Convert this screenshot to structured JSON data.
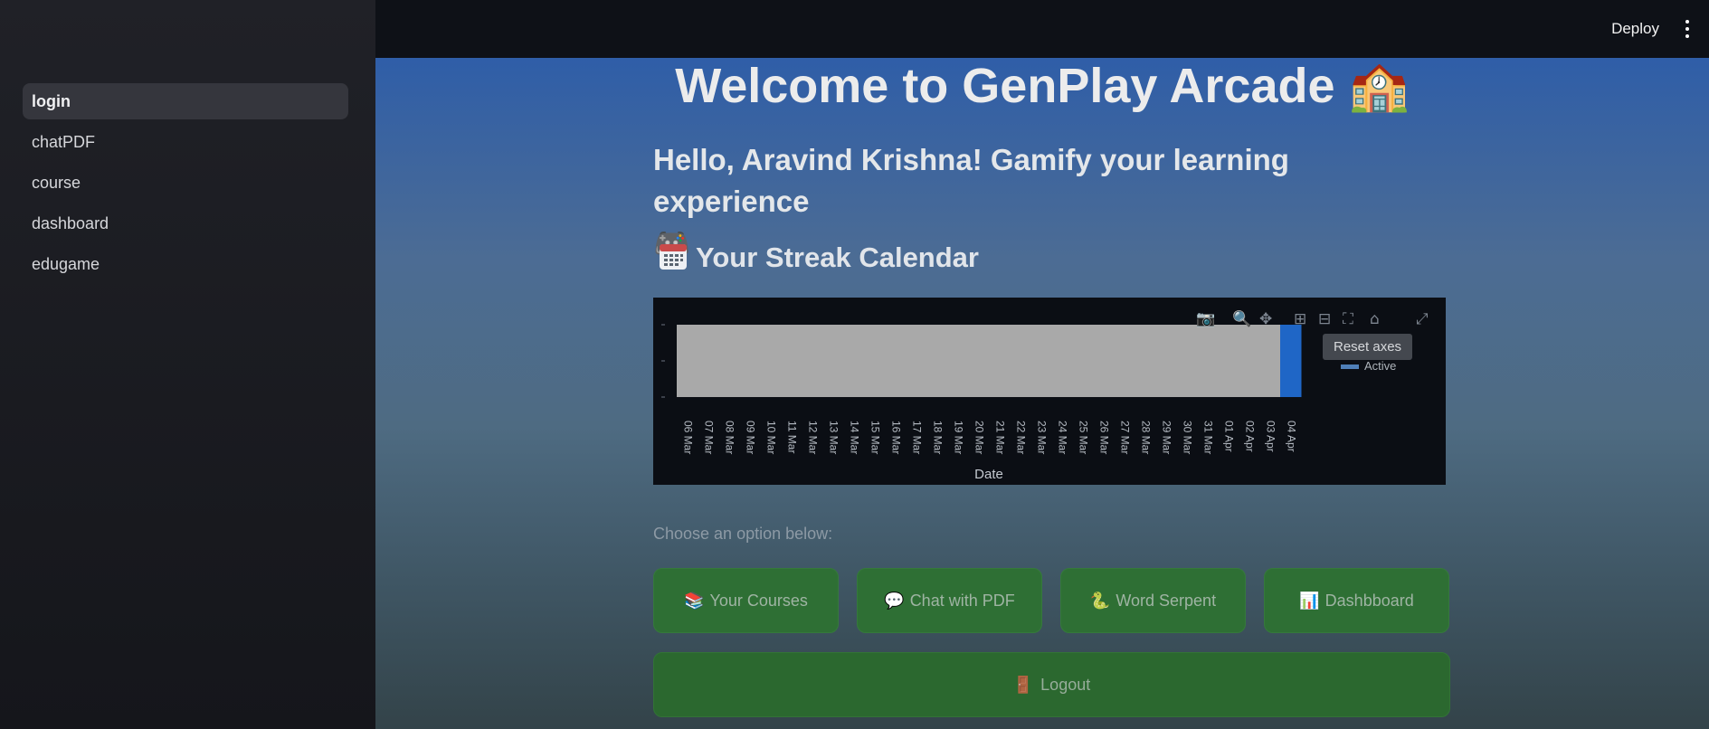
{
  "sidebar": {
    "items": [
      {
        "label": "login",
        "active": true
      },
      {
        "label": "chatPDF"
      },
      {
        "label": "course"
      },
      {
        "label": "dashboard"
      },
      {
        "label": "edugame"
      }
    ]
  },
  "topbar": {
    "deploy_label": "Deploy",
    "menu_icon": "kebab-menu-icon"
  },
  "main": {
    "title": "Welcome to GenPlay Arcade 🏫",
    "greeting_line1": "Hello, Aravind Krishna! Gamify your learning experience",
    "greeting_emoji": "🎮",
    "streak_heading": "Your Streak Calendar",
    "streak_icon": "calendar-icon",
    "choose_label": "Choose an option below:",
    "buttons": [
      {
        "label": "Your Courses",
        "icon": "📚"
      },
      {
        "label": "Chat with PDF",
        "icon": "💬"
      },
      {
        "label": "Word Serpent",
        "icon": "🐍"
      },
      {
        "label": "Dashbboard",
        "icon": "📊"
      }
    ],
    "logout": {
      "label": "Logout",
      "icon": "🚪"
    }
  },
  "modebar": {
    "tooltip": "Reset axes",
    "icons": [
      "camera-icon",
      "zoom-icon",
      "pan-icon",
      "zoom-in-icon",
      "zoom-out-icon",
      "autoscale-icon",
      "reset-axes-icon",
      "fullscreen-icon"
    ]
  },
  "colors": {
    "inactive": "#a9a9a9",
    "active": "#1f66c6"
  },
  "chart_data": {
    "type": "heatmap",
    "xlabel": "Date",
    "ylabel": "",
    "x": [
      "06 Mar",
      "07 Mar",
      "08 Mar",
      "09 Mar",
      "10 Mar",
      "11 Mar",
      "12 Mar",
      "13 Mar",
      "14 Mar",
      "15 Mar",
      "16 Mar",
      "17 Mar",
      "18 Mar",
      "19 Mar",
      "20 Mar",
      "21 Mar",
      "22 Mar",
      "23 Mar",
      "24 Mar",
      "25 Mar",
      "26 Mar",
      "27 Mar",
      "28 Mar",
      "29 Mar",
      "30 Mar",
      "31 Mar",
      "01 Apr",
      "02 Apr",
      "03 Apr",
      "04 Apr"
    ],
    "values": [
      0,
      0,
      0,
      0,
      0,
      0,
      0,
      0,
      0,
      0,
      0,
      0,
      0,
      0,
      0,
      0,
      0,
      0,
      0,
      0,
      0,
      0,
      0,
      0,
      0,
      0,
      0,
      0,
      0,
      1
    ],
    "legend": [
      {
        "name": "Active"
      }
    ],
    "grid": false
  }
}
